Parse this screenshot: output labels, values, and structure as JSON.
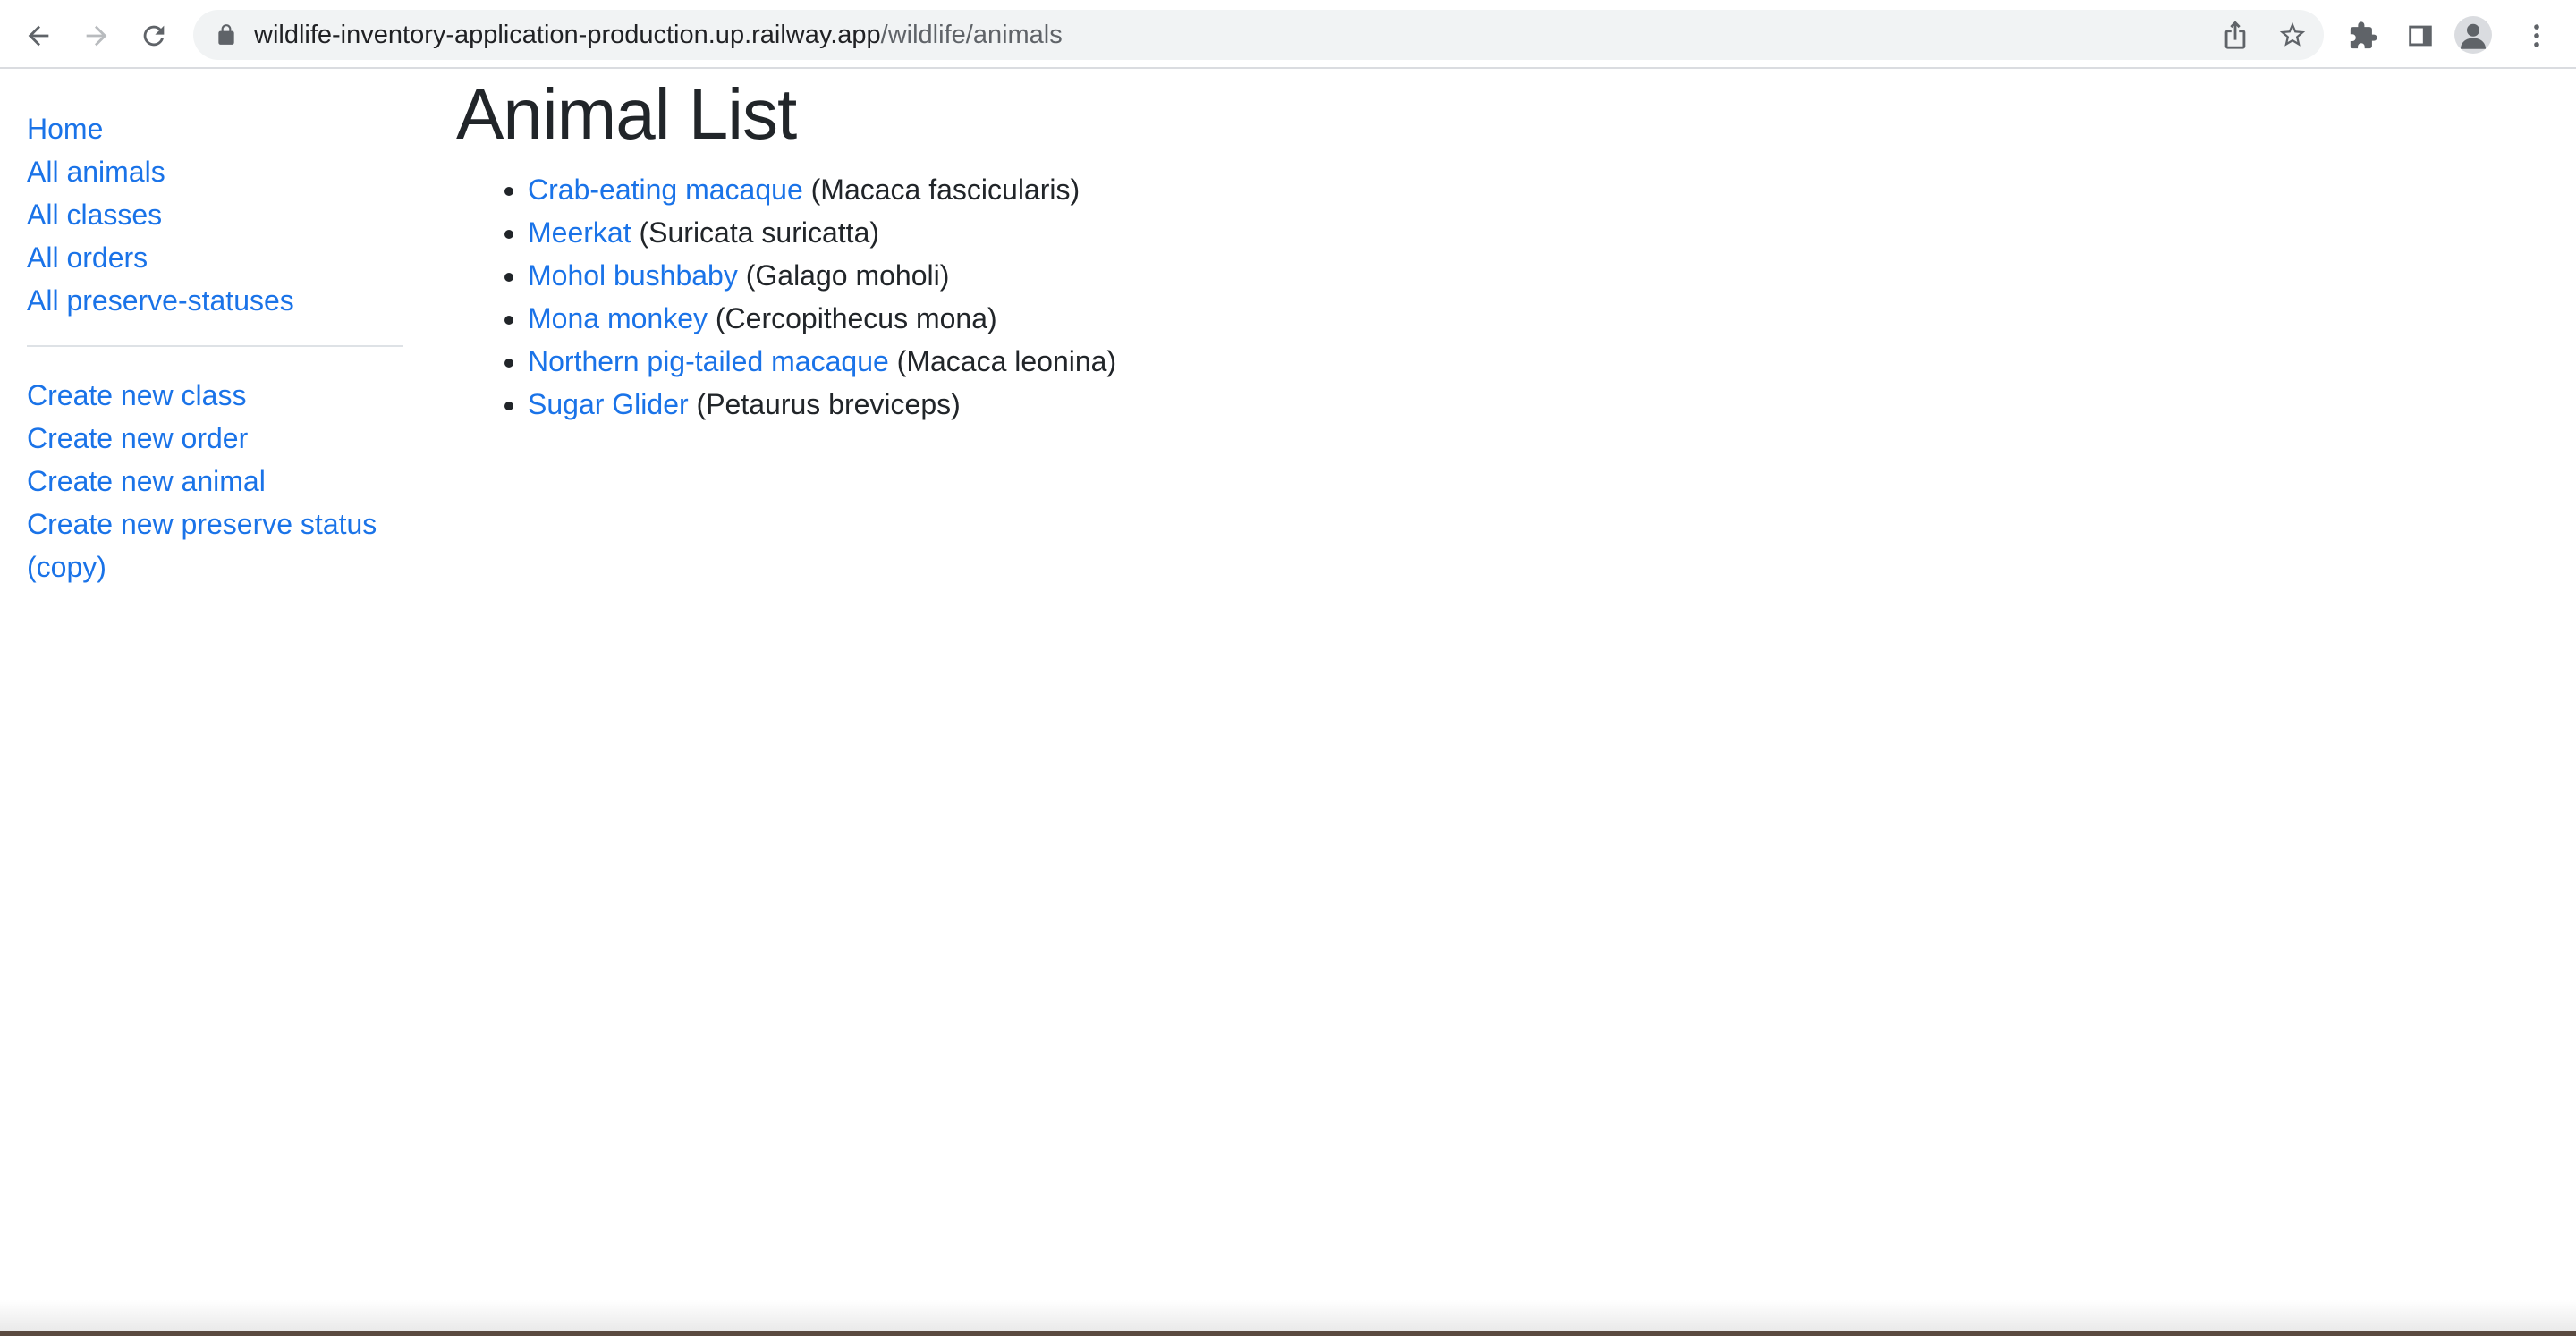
{
  "browser": {
    "url_host": "wildlife-inventory-application-production.up.railway.app",
    "url_path": "/wildlife/animals",
    "icons": [
      "back-arrow-icon",
      "forward-arrow-icon",
      "reload-icon",
      "lock-icon",
      "share-icon",
      "star-icon",
      "extensions-icon",
      "side-panel-icon",
      "profile-icon",
      "menu-kebab-icon"
    ]
  },
  "sidebar": {
    "nav_links": [
      {
        "label": "Home"
      },
      {
        "label": "All animals"
      },
      {
        "label": "All classes"
      },
      {
        "label": "All orders"
      },
      {
        "label": "All preserve-statuses"
      }
    ],
    "create_links": [
      {
        "label": "Create new class"
      },
      {
        "label": "Create new order"
      },
      {
        "label": "Create new animal"
      },
      {
        "label": "Create new preserve status"
      },
      {
        "label": "(copy)"
      }
    ]
  },
  "main": {
    "title": "Animal List",
    "animals": [
      {
        "name": "Crab-eating macaque",
        "scientific": "(Macaca fascicularis)"
      },
      {
        "name": "Meerkat",
        "scientific": "(Suricata suricatta)"
      },
      {
        "name": "Mohol bushbaby",
        "scientific": "(Galago moholi)"
      },
      {
        "name": "Mona monkey",
        "scientific": "(Cercopithecus mona)"
      },
      {
        "name": "Northern pig-tailed macaque",
        "scientific": "(Macaca leonina)"
      },
      {
        "name": "Sugar Glider",
        "scientific": "(Petaurus breviceps)"
      }
    ]
  },
  "colors": {
    "link": "#1a73e8",
    "text": "#212529",
    "chrome_bg": "#ffffff",
    "omnibox_bg": "#f1f3f4"
  }
}
